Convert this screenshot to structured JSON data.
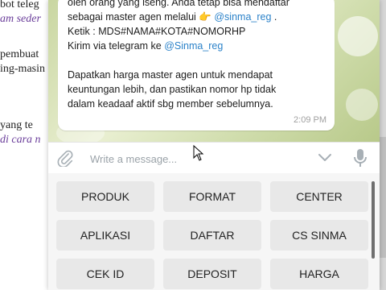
{
  "document": {
    "lines": [
      {
        "text": "bot teleg",
        "style": "plain"
      },
      {
        "text": "am seder",
        "style": "link"
      },
      {
        "text": "pembuat",
        "style": "plain"
      },
      {
        "text": "ing-masin",
        "style": "plain"
      },
      {
        "text": "yang  te",
        "style": "plain"
      },
      {
        "text": "di  cara n",
        "style": "link"
      }
    ]
  },
  "chat": {
    "message": {
      "line1": "oleh orang yang iseng. Anda tetap bisa mendaftar",
      "line2_prefix": "sebagai master agen melalui ",
      "line2_emoji": "👉",
      "line2_mention": "@sinma_reg",
      "line2_suffix": " .",
      "line3": "Ketik : MDS#NAMA#KOTA#NOMORHP",
      "line4_prefix": "Kirim via telegram ke ",
      "line4_mention": "@Sinma_reg",
      "line5": "Dapatkan harga master agen untuk mendapat",
      "line6": "keuntungan lebih, dan pastikan nomor hp tidak",
      "line7": "dalam keadaaf aktif sbg member sebelumnya.",
      "time": "2:09 PM"
    }
  },
  "composer": {
    "placeholder": "Write a message...",
    "icons": [
      "paperclip-icon",
      "chevron-down-icon",
      "microphone-icon"
    ]
  },
  "keyboard": {
    "buttons": [
      "PRODUK",
      "FORMAT",
      "CENTER",
      "APLIKASI",
      "DAFTAR",
      "CS SINMA",
      "CEK ID",
      "DEPOSIT",
      "HARGA"
    ]
  },
  "colors": {
    "mention": "#2b82c9",
    "button_bg": "#e8e8e8",
    "chat_bg": "#c9d6a1"
  }
}
